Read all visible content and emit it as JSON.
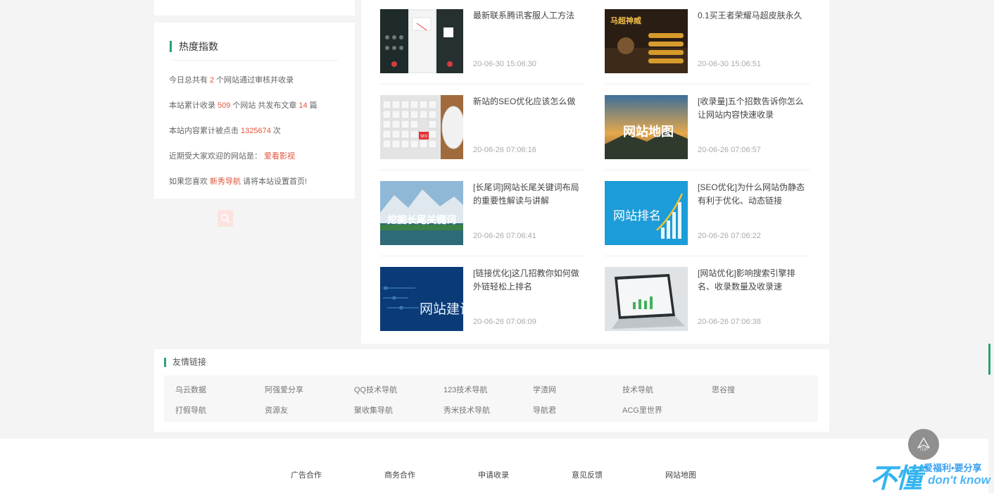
{
  "hot": {
    "title": "热度指数",
    "line1": {
      "pre": "今日总共有",
      "num": "2",
      "post": "个网站通过审核并收录"
    },
    "line2": {
      "pre": "本站累计收录",
      "num1": "509",
      "mid": "个网站 共发布文章",
      "num2": "14",
      "post": "篇"
    },
    "line3": {
      "pre": "本站内容累计被点击",
      "num": "1325674",
      "post": "次"
    },
    "line4": {
      "pre": "近期受大家欢迎的网站是：",
      "link": "爱看影视"
    },
    "line5": {
      "pre": "如果您喜欢",
      "link": "新秀导航",
      "post": "请将本站设置首页!"
    }
  },
  "search_icon": "search-icon",
  "posts": [
    {
      "title": "最新联系腾讯客服人工方法",
      "time": "20-06-30 15:06:30"
    },
    {
      "title": "0.1买王者荣耀马超皮肤永久",
      "time": "20-06-30 15:06:51"
    },
    {
      "title": "新站的SEO优化应该怎么做",
      "time": "20-06-26 07:06:16"
    },
    {
      "title": "[收录量]五个招数告诉你怎么让网站内容快速收录",
      "time": "20-06-26 07:06:57"
    },
    {
      "title": "[长尾词]网站长尾关键词布局的重要性解读与讲解",
      "time": "20-06-26 07:06:41"
    },
    {
      "title": "[SEO优化]为什么网站伪静态有利于优化、动态链接",
      "time": "20-06-26 07:06:22"
    },
    {
      "title": "[链接优化]这几招教你如何做外链轻松上排名",
      "time": "20-06-26 07:06:09"
    },
    {
      "title": "[网站优化]影响搜索引擎排名、收录数量及收录速",
      "time": "20-06-26 07:06:38"
    }
  ],
  "thumb_text": {
    "game_title": "马超神威",
    "seo_key": "SEO",
    "sitemap": "网站地图",
    "longtail": "挖掘长尾关键词",
    "ranking": "网站排名",
    "building": "网站建设"
  },
  "friends": {
    "title": "友情链接",
    "row1": [
      "乌云数据",
      "阿强爱分享",
      "QQ技术导航",
      "123技术导航",
      "学渣网",
      "技术导航",
      "思谷搜"
    ],
    "row2": [
      "打假导航",
      "资源友",
      "聚收集导航",
      "秀米技术导航",
      "导航君",
      "ACG里世界"
    ]
  },
  "footer": [
    "广告合作",
    "商务合作",
    "申请收录",
    "意见反馈",
    "网站地图"
  ],
  "top_button": {
    "label": "TOP"
  },
  "watermark": {
    "big": "不懂",
    "line1": "爱福利•要分享",
    "line2": "don't know"
  },
  "colors": {
    "accent": "#2aa272",
    "highlight": "#e5533b"
  }
}
